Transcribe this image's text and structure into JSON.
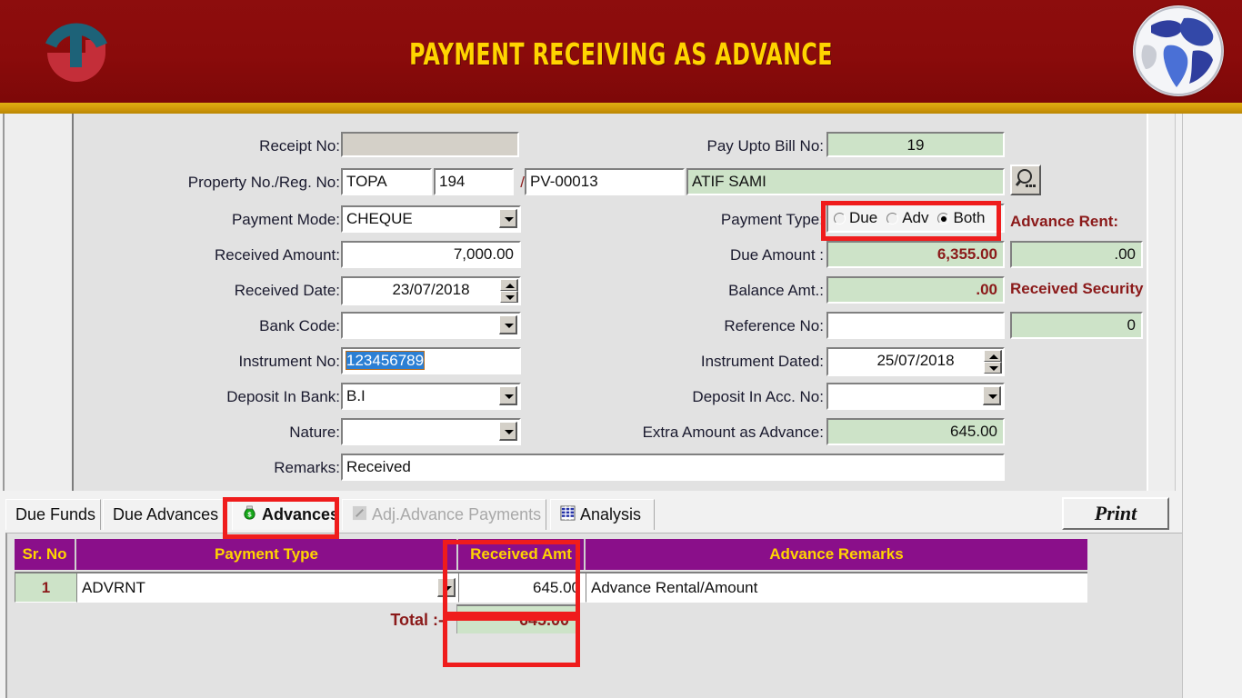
{
  "header": {
    "title": "PAYMENT RECEIVING AS ADVANCE",
    "logo_left_name": "company-logo",
    "logo_right_name": "globe-icon",
    "bg_color": "#8a0b0b",
    "title_color": "#ffd400",
    "underline_color": "#d39e09"
  },
  "form": {
    "left": {
      "receipt_no_label": "Receipt No:",
      "receipt_no_value": "",
      "property_reg_label": "Property No./Reg. No:",
      "property_code": "TOPA",
      "property_number": "194",
      "slash": "/",
      "reg_no": "PV-00013",
      "payment_mode_label": "Payment Mode:",
      "payment_mode_value": "CHEQUE",
      "received_amount_label": "Received Amount:",
      "received_amount_value": "7,000.00",
      "received_date_label": "Received Date:",
      "received_date_value": "23/07/2018",
      "bank_code_label": "Bank Code:",
      "bank_code_value": "",
      "instrument_no_label": "Instrument No:",
      "instrument_no_value": "123456789",
      "deposit_in_bank_label": "Deposit In Bank:",
      "deposit_in_bank_value": "B.I",
      "nature_label": "Nature:",
      "nature_value": "",
      "remarks_label": "Remarks:",
      "remarks_value": "Received"
    },
    "right": {
      "pay_upto_bill_label": "Pay Upto Bill No:",
      "pay_upto_bill_value": "19",
      "tenant_name": "ATIF SAMI",
      "search_icon_name": "magnifier-icon",
      "payment_type_label": "Payment Type:",
      "payment_type_options": [
        "Due",
        "Adv",
        "Both"
      ],
      "payment_type_selected": "Both",
      "due_amount_label": "Due Amount :",
      "due_amount_value": "6,355.00",
      "balance_amt_label": "Balance Amt.:",
      "balance_amt_value": ".00",
      "reference_no_label": "Reference No:",
      "reference_no_value": "",
      "instrument_dated_label": "Instrument Dated:",
      "instrument_dated_value": "25/07/2018",
      "deposit_in_acc_label": "Deposit In Acc. No:",
      "deposit_in_acc_value": "",
      "extra_amount_label": "Extra Amount as Advance:",
      "extra_amount_value": "645.00"
    },
    "far_right": {
      "advance_rent_label": "Advance Rent:",
      "advance_rent_value": ".00",
      "received_security_label": "Received Security",
      "received_security_value": "0"
    }
  },
  "tabs": [
    {
      "label": "Due Funds",
      "icon": "",
      "active": false,
      "disabled": false
    },
    {
      "label": "Due Advances",
      "icon": "",
      "active": false,
      "disabled": false
    },
    {
      "label": "Advances",
      "icon": "money-bag-icon",
      "active": true,
      "disabled": false
    },
    {
      "label": "Adj.Advance Payments",
      "icon": "pencil-icon",
      "active": false,
      "disabled": true
    },
    {
      "label": "Analysis",
      "icon": "grid-icon",
      "active": false,
      "disabled": false
    }
  ],
  "print_button": {
    "label": "Print"
  },
  "grid": {
    "columns": [
      "Sr. No",
      "Payment Type",
      "Received Amt",
      "Advance Remarks"
    ],
    "rows": [
      {
        "sr_no": "1",
        "payment_type": "ADVRNT",
        "received_amt": "645.00",
        "advance_remarks": "Advance Rental/Amount"
      }
    ],
    "total_label": "Total :-",
    "total_value": "645.00",
    "header_bg": "#8a0f8a",
    "header_text_color": "#ffd400"
  },
  "annotations": {
    "highlight_color": "#ef1c1c",
    "boxes": [
      "payment-type-radio-group",
      "advances-tab",
      "received-amt-column",
      "total-value"
    ]
  }
}
